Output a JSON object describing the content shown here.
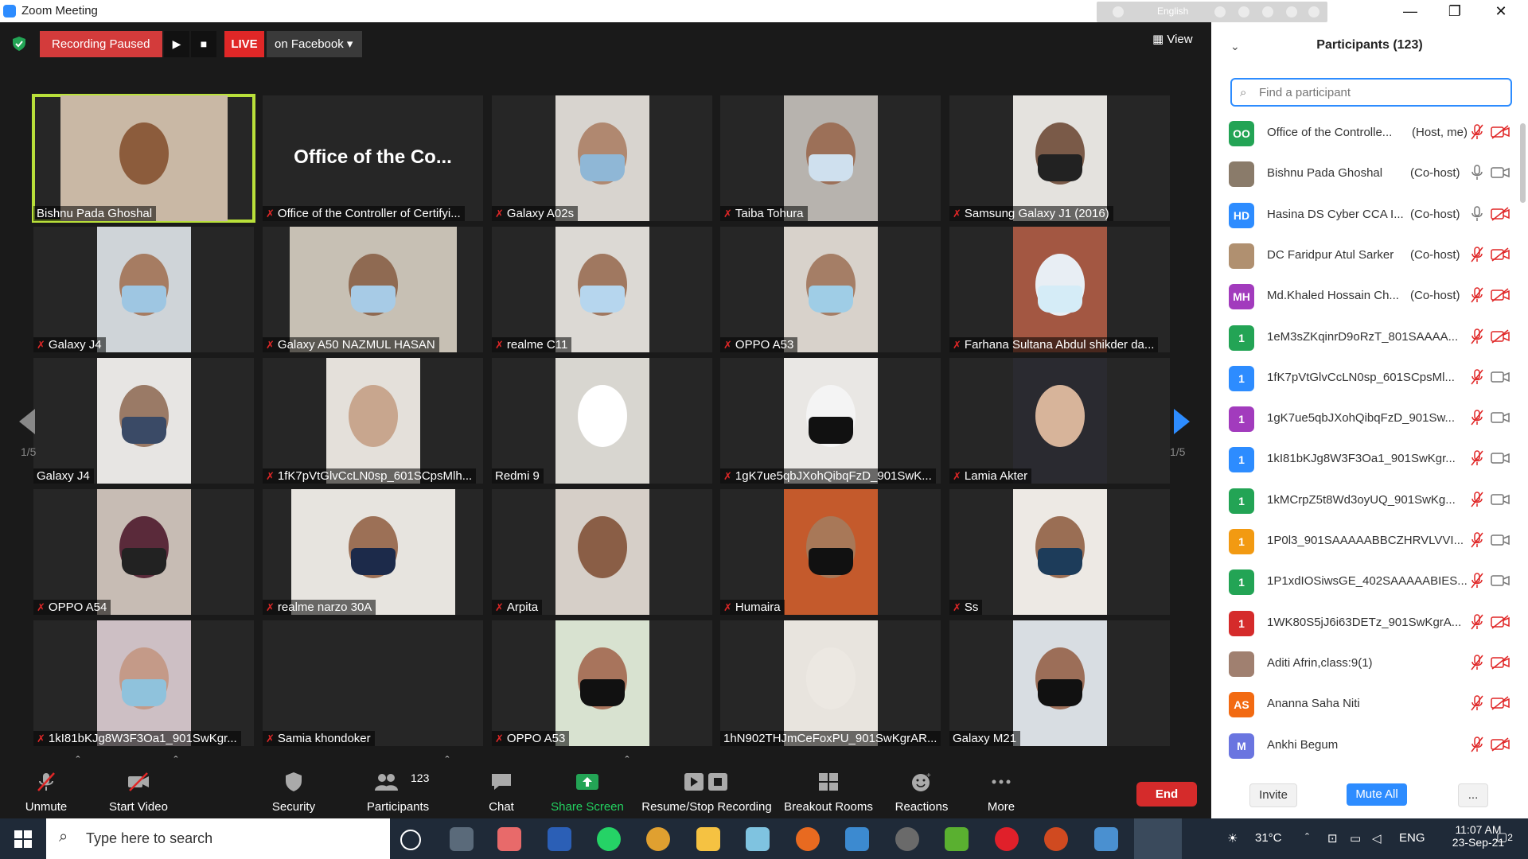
{
  "window": {
    "title": "Zoom Meeting",
    "lang": "English"
  },
  "status": {
    "recording": "Recording Paused",
    "live": "LIVE",
    "stream": "on Facebook",
    "view": "View"
  },
  "tiles": [
    {
      "name": "Bishnu Pada Ghoshal",
      "muted": false
    },
    {
      "name": "Office of the Controller of Certifyi...",
      "big": "Office of the Co...",
      "muted": true
    },
    {
      "name": "Galaxy A02s",
      "muted": true
    },
    {
      "name": "Taiba Tohura",
      "muted": true
    },
    {
      "name": "Samsung Galaxy J1 (2016)",
      "muted": true
    },
    {
      "name": "Galaxy J4",
      "muted": true
    },
    {
      "name": "Galaxy A50    NAZMUL HASAN",
      "muted": true
    },
    {
      "name": "realme C11",
      "muted": true
    },
    {
      "name": "OPPO A53",
      "muted": true
    },
    {
      "name": "Farhana Sultana Abdul shikder da...",
      "muted": true
    },
    {
      "name": "Galaxy J4",
      "muted": false
    },
    {
      "name": "1fK7pVtGlvCcLN0sp_601SCpsMlh...",
      "muted": true
    },
    {
      "name": "Redmi 9",
      "muted": false
    },
    {
      "name": "1gK7ue5qbJXohQibqFzD_901SwK...",
      "muted": true
    },
    {
      "name": "Lamia Akter",
      "muted": true
    },
    {
      "name": "OPPO A54",
      "muted": true
    },
    {
      "name": "realme narzo 30A",
      "muted": true
    },
    {
      "name": "Arpita",
      "muted": true
    },
    {
      "name": "Humaira",
      "muted": true
    },
    {
      "name": "Ss",
      "muted": true
    },
    {
      "name": "1kI81bKJg8W3F3Oa1_901SwKgr...",
      "muted": true
    },
    {
      "name": "Samia khondoker",
      "muted": true
    },
    {
      "name": "OPPO A53",
      "muted": true
    },
    {
      "name": "1hN902THJmCeFoxPU_901SwKgrAR...",
      "muted": false
    },
    {
      "name": "Galaxy M21",
      "muted": false
    }
  ],
  "pagination": {
    "left": "1/5",
    "right": "1/5"
  },
  "toolbar": {
    "unmute": "Unmute",
    "start_video": "Start Video",
    "security": "Security",
    "participants": "Participants",
    "participant_count": "123",
    "chat": "Chat",
    "share": "Share Screen",
    "recording": "Resume/Stop Recording",
    "breakout": "Breakout Rooms",
    "reactions": "Reactions",
    "more": "More",
    "end": "End"
  },
  "panel": {
    "title": "Participants (123)",
    "search_placeholder": "Find a participant",
    "invite": "Invite",
    "mute_all": "Mute All",
    "more": "...",
    "participants": [
      {
        "initials": "OO",
        "color": "#23a455",
        "name": "Office of the Controlle...",
        "role": "(Host, me)",
        "mic_muted": true,
        "cam_off": true
      },
      {
        "initials": "",
        "color": "#8a7b6a",
        "name": "Bishnu Pada Ghoshal",
        "role": "(Co-host)",
        "mic_muted": false,
        "cam_off": false
      },
      {
        "initials": "HD",
        "color": "#2d8cff",
        "name": "Hasina DS Cyber CCA I...",
        "role": "(Co-host)",
        "mic_muted": false,
        "cam_off": true
      },
      {
        "initials": "",
        "color": "#b09070",
        "name": "DC Faridpur Atul Sarker",
        "role": "(Co-host)",
        "mic_muted": true,
        "cam_off": true
      },
      {
        "initials": "MH",
        "color": "#a23bbd",
        "name": "Md.Khaled Hossain Ch...",
        "role": "(Co-host)",
        "mic_muted": true,
        "cam_off": true
      },
      {
        "initials": "1",
        "color": "#23a455",
        "name": "1eM3sZKqinrD9oRzT_801SAAAA...",
        "role": "",
        "mic_muted": true,
        "cam_off": true
      },
      {
        "initials": "1",
        "color": "#2d8cff",
        "name": "1fK7pVtGlvCcLN0sp_601SCpsMl...",
        "role": "",
        "mic_muted": true,
        "cam_off": false
      },
      {
        "initials": "1",
        "color": "#a23bbd",
        "name": "1gK7ue5qbJXohQibqFzD_901Sw...",
        "role": "",
        "mic_muted": true,
        "cam_off": false
      },
      {
        "initials": "1",
        "color": "#2d8cff",
        "name": "1kI81bKJg8W3F3Oa1_901SwKgr...",
        "role": "",
        "mic_muted": true,
        "cam_off": false
      },
      {
        "initials": "1",
        "color": "#23a455",
        "name": "1kMCrpZ5t8Wd3oyUQ_901SwKg...",
        "role": "",
        "mic_muted": true,
        "cam_off": false
      },
      {
        "initials": "1",
        "color": "#f29a12",
        "name": "1P0l3_901SAAAAABBCZHRVLVVI...",
        "role": "",
        "mic_muted": true,
        "cam_off": false
      },
      {
        "initials": "1",
        "color": "#23a455",
        "name": "1P1xdIOSiwsGE_402SAAAAABIES...",
        "role": "",
        "mic_muted": true,
        "cam_off": false
      },
      {
        "initials": "1",
        "color": "#d52b2b",
        "name": "1WK80S5jJ6i63DETz_901SwKgrA...",
        "role": "",
        "mic_muted": true,
        "cam_off": true
      },
      {
        "initials": "",
        "color": "#a08070",
        "name": "Aditi Afrin,class:9(1)",
        "role": "",
        "mic_muted": true,
        "cam_off": true
      },
      {
        "initials": "AS",
        "color": "#f26a12",
        "name": "Ananna Saha Niti",
        "role": "",
        "mic_muted": true,
        "cam_off": true
      },
      {
        "initials": "M",
        "color": "#6a75e0",
        "name": "Ankhi Begum",
        "role": "",
        "mic_muted": true,
        "cam_off": true
      }
    ]
  },
  "taskbar": {
    "search": "Type here to search",
    "temp": "31°C",
    "lang": "ENG",
    "time": "11:07 AM",
    "date": "23-Sep-21",
    "notifications": "2"
  }
}
